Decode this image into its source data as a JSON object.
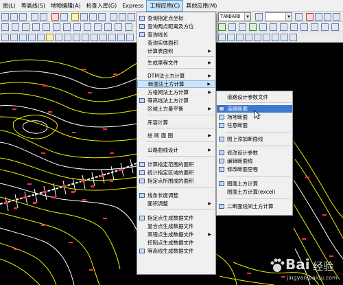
{
  "menubar": {
    "items": [
      "图(L)",
      "等高线(S)",
      "地物编辑(A)",
      "检查入库(G)",
      "Express",
      "工程应用(C)",
      "其他应用(M)"
    ]
  },
  "toolbar": {
    "style_combo": "TANDARD"
  },
  "main_menu": {
    "items": [
      "查询指定点坐标",
      "查询两点距离及方位",
      "查询线长",
      "查询实体面积",
      "计算表面积",
      "生成里程文件",
      "DTM法土方计算",
      "断面法土方计算",
      "方格网法土方计算",
      "等高线法土方计算",
      "区域土方量平衡",
      "库容计算",
      "绘 断 面 图",
      "公路曲线设计",
      "计算指定范围的面积",
      "统计指定区域的面积",
      "指定点所围成的面积",
      "线条长度调整",
      "面积调整",
      "指定点生成数据文件",
      "复合点生成数据文件",
      "高程点生成数据文件",
      "控制点生成数据文件",
      "等高线生成数据文件"
    ]
  },
  "sub_menu": {
    "items": [
      "道路设计参数文件",
      "道路断面",
      "场地断面",
      "任意断面",
      "图上添加断面线",
      "修改设计参数",
      "编辑断面线",
      "修改断面里程",
      "图面土方计算",
      "图面土方计算(excel)",
      "二断面线间土方计算"
    ]
  },
  "watermark": {
    "brand": "Bai",
    "brand_cn": "经验",
    "url": "jingyan.baidu.com"
  },
  "colors": {
    "contour": "#f0f000",
    "contour_alt": "#ffffff",
    "road": "#ff2d4a",
    "menu_highlight": "#3f78d0",
    "menu_hover": "#cce4f7"
  }
}
